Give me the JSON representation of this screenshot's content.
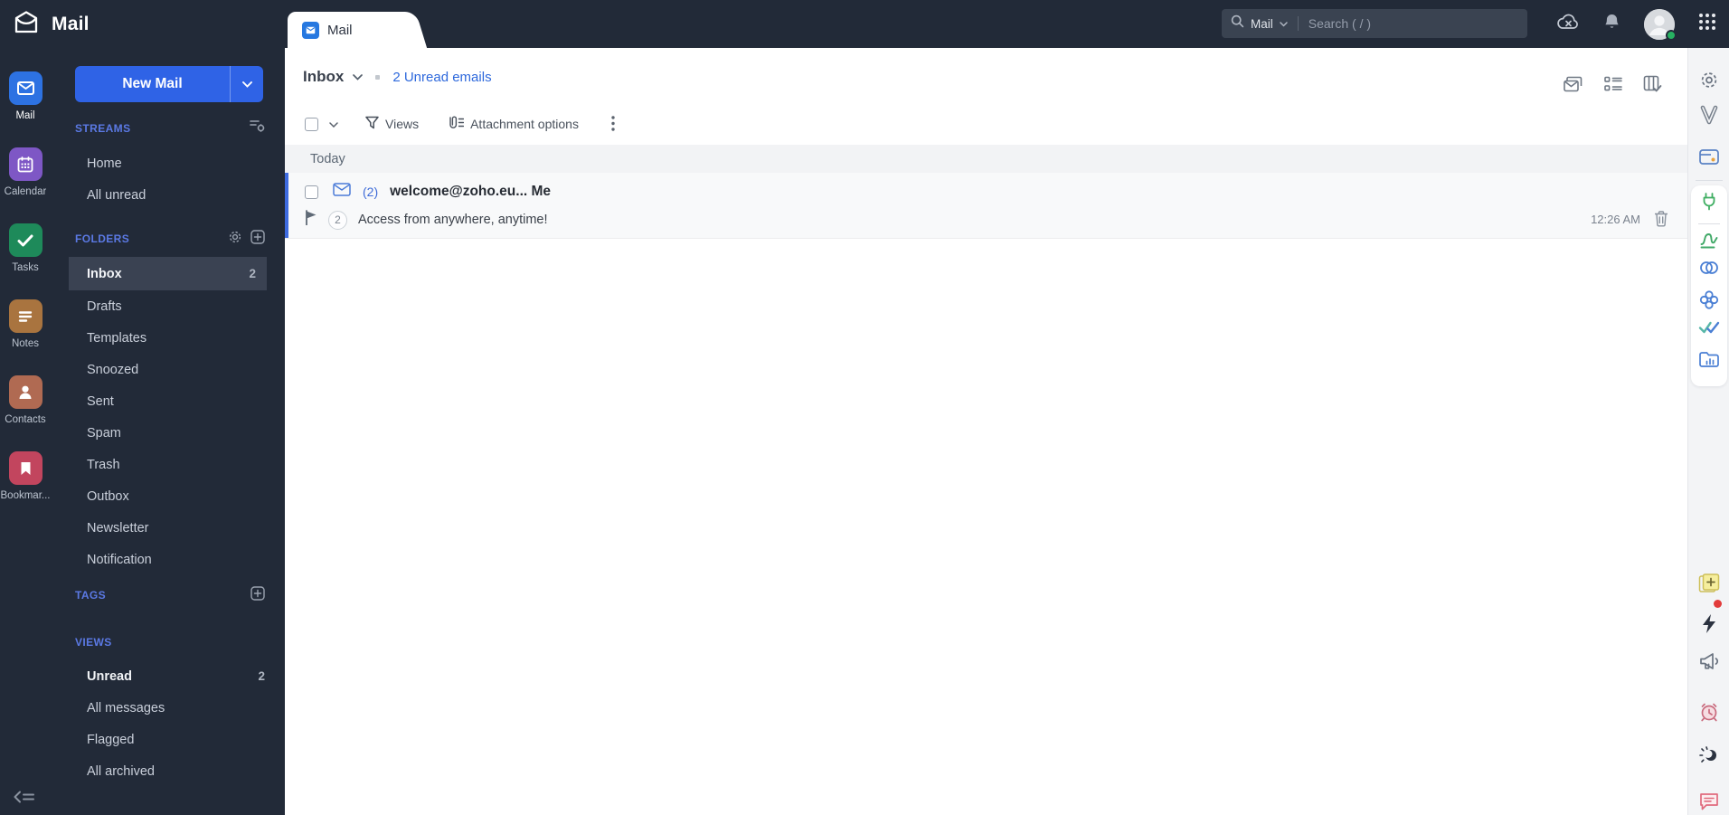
{
  "colors": {
    "topbar_bg": "#222a38",
    "sidebar_bg": "#222a38",
    "accent_blue": "#2f63e6",
    "link_blue": "#2d68dc",
    "section_header_blue": "#5b79e4",
    "selected_item_bg": "#3a4252",
    "unread_bar_blue": "#3e6be0",
    "band_bg": "#f2f3f5",
    "row_bg": "#f8f9fa",
    "right_rail_bg": "#f3f4f6",
    "status_green": "#27b161"
  },
  "topbar": {
    "app_title": "Mail",
    "search": {
      "scope_label": "Mail",
      "placeholder": "Search ( / )"
    },
    "icons": [
      "offline-cloud-icon",
      "notifications-bell-icon",
      "user-avatar",
      "apps-grid-icon"
    ]
  },
  "app_rail": {
    "items": [
      {
        "label": "Mail",
        "icon": "mail-app-icon",
        "color": "#2d72e2",
        "active": true
      },
      {
        "label": "Calendar",
        "icon": "calendar-app-icon",
        "color": "#7e57c5",
        "active": false
      },
      {
        "label": "Tasks",
        "icon": "tasks-app-icon",
        "color": "#1e8a5a",
        "active": false
      },
      {
        "label": "Notes",
        "icon": "notes-app-icon",
        "color": "#a9743f",
        "active": false
      },
      {
        "label": "Contacts",
        "icon": "contacts-app-icon",
        "color": "#b06a52",
        "active": false
      },
      {
        "label": "Bookmar...",
        "icon": "bookmarks-app-icon",
        "color": "#c2455e",
        "active": false
      }
    ],
    "collapse_icon": "collapse-sidebar-icon"
  },
  "sidebar": {
    "new_mail_label": "New Mail",
    "streams": {
      "title": "STREAMS",
      "items": [
        {
          "label": "Home"
        },
        {
          "label": "All unread"
        }
      ]
    },
    "folders": {
      "title": "FOLDERS",
      "items": [
        {
          "label": "Inbox",
          "count": "2",
          "selected": true
        },
        {
          "label": "Drafts"
        },
        {
          "label": "Templates"
        },
        {
          "label": "Snoozed"
        },
        {
          "label": "Sent"
        },
        {
          "label": "Spam"
        },
        {
          "label": "Trash"
        },
        {
          "label": "Outbox"
        },
        {
          "label": "Newsletter"
        },
        {
          "label": "Notification"
        }
      ]
    },
    "tags": {
      "title": "TAGS"
    },
    "views": {
      "title": "VIEWS",
      "items": [
        {
          "label": "Unread",
          "count": "2",
          "bold": true
        },
        {
          "label": "All messages"
        },
        {
          "label": "Flagged"
        },
        {
          "label": "All archived"
        }
      ]
    }
  },
  "main": {
    "tab_label": "Mail",
    "header": {
      "folder": "Inbox",
      "unread_link": "2 Unread emails"
    },
    "toolbar": {
      "views_label": "Views",
      "attachment_label": "Attachment options"
    },
    "list": {
      "group_label": "Today",
      "emails": [
        {
          "unread_count": "(2)",
          "sender": "welcome@zoho.eu... Me",
          "thread_count": "2",
          "subject": "Access from anywhere, anytime!",
          "time": "12:26 AM"
        }
      ]
    }
  },
  "right_rail": {
    "icons": [
      "settings-gear-icon",
      "vani-icon",
      "wallet-icon",
      "power-plug-icon",
      "sign-icon",
      "linked-rings-icon",
      "knot-icon",
      "double-check-icon",
      "folder-chart-icon",
      "sticky-note-icon",
      "lightning-icon",
      "megaphone-icon",
      "alarm-clock-icon",
      "night-mode-icon",
      "feedback-chat-icon"
    ]
  }
}
